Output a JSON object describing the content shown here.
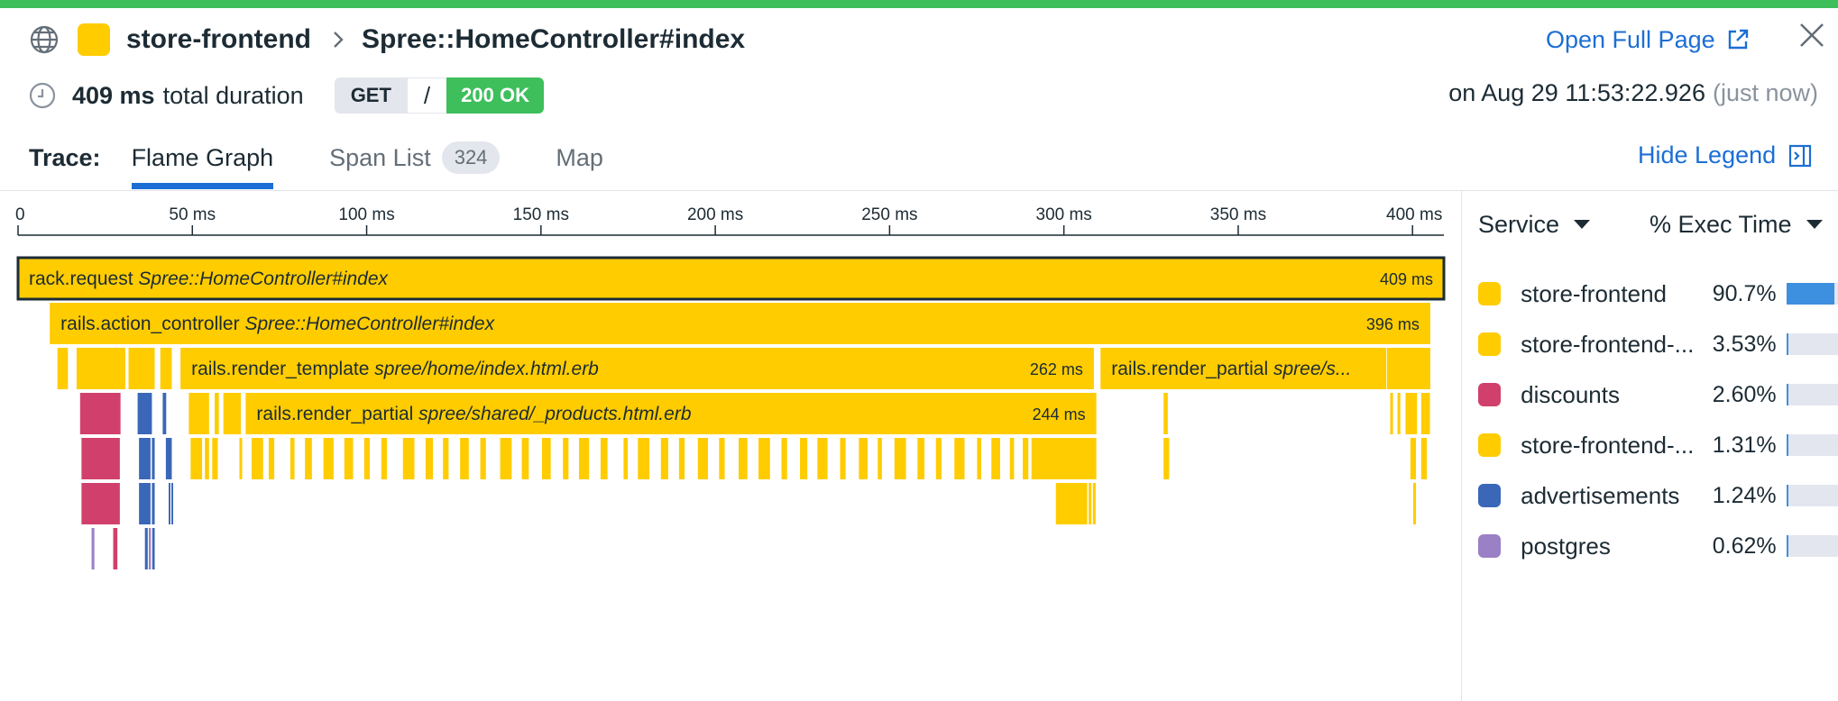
{
  "header": {
    "service": "store-frontend",
    "resource": "Spree::HomeController#index",
    "open_full_page": "Open Full Page",
    "duration_value": "409 ms",
    "duration_label": "total duration",
    "http_method": "GET",
    "http_path": "/",
    "http_status": "200 OK",
    "timestamp": "on Aug 29 11:53:22.926",
    "timestamp_relative": "(just now)"
  },
  "colors": {
    "accent": "#1c6ed4",
    "success": "#3ebf5c",
    "store_frontend": "#ffcc00",
    "discounts": "#d1406c",
    "advertisements": "#3a67b7",
    "postgres": "#9a80c4"
  },
  "tabs": {
    "trace_label": "Trace:",
    "items": [
      {
        "label": "Flame Graph",
        "active": true
      },
      {
        "label": "Span List",
        "count": "324",
        "active": false
      },
      {
        "label": "Map",
        "active": false
      }
    ],
    "hide_legend": "Hide Legend"
  },
  "flame": {
    "axis_max_ms": 409,
    "ticks": [
      {
        "value": 0,
        "label": "0"
      },
      {
        "value": 50,
        "label": "50 ms"
      },
      {
        "value": 100,
        "label": "100 ms"
      },
      {
        "value": 150,
        "label": "150 ms"
      },
      {
        "value": 200,
        "label": "200 ms"
      },
      {
        "value": 250,
        "label": "250 ms"
      },
      {
        "value": 300,
        "label": "300 ms"
      },
      {
        "value": 350,
        "label": "350 ms"
      },
      {
        "value": 400,
        "label": "400 ms"
      }
    ],
    "spans": [
      {
        "depth": 0,
        "start": 0,
        "duration": 409,
        "service": "store_frontend",
        "name": "rack.request",
        "resource": "Spree::HomeController#index",
        "dur_label": "409 ms",
        "selected": true
      },
      {
        "depth": 1,
        "start": 9.1,
        "duration": 396,
        "service": "store_frontend",
        "name": "rails.action_controller",
        "resource": "Spree::HomeController#index",
        "dur_label": "396 ms"
      },
      {
        "depth": 2,
        "start": 46.6,
        "duration": 262,
        "service": "store_frontend",
        "name": "rails.render_template",
        "resource": "spree/home/index.html.erb",
        "dur_label": "262 ms"
      },
      {
        "depth": 2,
        "start": 310.5,
        "duration": 82,
        "service": "store_frontend",
        "name": "rails.render_partial",
        "resource": "spree/s...",
        "dur_label": ""
      },
      {
        "depth": 3,
        "start": 65.3,
        "duration": 244,
        "service": "store_frontend",
        "name": "rails.render_partial",
        "resource": "spree/shared/_products.html.erb",
        "dur_label": "244 ms"
      }
    ],
    "slivers": [
      {
        "depth": 2,
        "start": 11.3,
        "duration": 3,
        "service": "store_frontend"
      },
      {
        "depth": 2,
        "start": 16.8,
        "duration": 14,
        "service": "store_frontend"
      },
      {
        "depth": 2,
        "start": 31.7,
        "duration": 7.5,
        "service": "store_frontend"
      },
      {
        "depth": 2,
        "start": 40.8,
        "duration": 3.3,
        "service": "store_frontend"
      },
      {
        "depth": 2,
        "start": 392.7,
        "duration": 12.4,
        "service": "store_frontend"
      },
      {
        "depth": 3,
        "start": 17.8,
        "duration": 11.6,
        "service": "discounts"
      },
      {
        "depth": 3,
        "start": 34.3,
        "duration": 4.1,
        "service": "advertisements"
      },
      {
        "depth": 3,
        "start": 41.5,
        "duration": 1,
        "service": "advertisements"
      },
      {
        "depth": 3,
        "start": 49,
        "duration": 5.8,
        "service": "store_frontend"
      },
      {
        "depth": 3,
        "start": 56.4,
        "duration": 1.2,
        "service": "store_frontend"
      },
      {
        "depth": 3,
        "start": 58.9,
        "duration": 5,
        "service": "store_frontend"
      },
      {
        "depth": 3,
        "start": 328.6,
        "duration": 1.2,
        "service": "store_frontend"
      },
      {
        "depth": 3,
        "start": 393.6,
        "duration": 0.8,
        "service": "store_frontend"
      },
      {
        "depth": 3,
        "start": 395.7,
        "duration": 0.8,
        "service": "store_frontend"
      },
      {
        "depth": 3,
        "start": 398,
        "duration": 3.3,
        "service": "store_frontend"
      },
      {
        "depth": 3,
        "start": 402.5,
        "duration": 2.5,
        "service": "store_frontend"
      },
      {
        "depth": 4,
        "start": 18.2,
        "duration": 11,
        "service": "discounts"
      },
      {
        "depth": 4,
        "start": 34.7,
        "duration": 3.3,
        "service": "advertisements"
      },
      {
        "depth": 4,
        "start": 38.4,
        "duration": 0.8,
        "service": "advertisements"
      },
      {
        "depth": 4,
        "start": 42.4,
        "duration": 1.7,
        "service": "advertisements"
      },
      {
        "depth": 4,
        "start": 49.5,
        "duration": 3.3,
        "service": "store_frontend"
      },
      {
        "depth": 4,
        "start": 53.6,
        "duration": 1.2,
        "service": "store_frontend"
      },
      {
        "depth": 4,
        "start": 55.7,
        "duration": 1.6,
        "service": "store_frontend"
      },
      {
        "depth": 4,
        "start": 63.5,
        "duration": 0.8,
        "service": "store_frontend"
      },
      {
        "depth": 4,
        "start": 67,
        "duration": 3.3,
        "service": "store_frontend"
      },
      {
        "depth": 4,
        "start": 71.9,
        "duration": 1.6,
        "service": "store_frontend"
      },
      {
        "depth": 4,
        "start": 78.1,
        "duration": 1.2,
        "service": "store_frontend"
      },
      {
        "depth": 4,
        "start": 82.3,
        "duration": 2,
        "service": "store_frontend"
      },
      {
        "depth": 4,
        "start": 87.6,
        "duration": 2.9,
        "service": "store_frontend"
      },
      {
        "depth": 4,
        "start": 93.6,
        "duration": 2.5,
        "service": "store_frontend"
      },
      {
        "depth": 4,
        "start": 99.3,
        "duration": 1.6,
        "service": "store_frontend"
      },
      {
        "depth": 4,
        "start": 104.2,
        "duration": 1.6,
        "service": "store_frontend"
      },
      {
        "depth": 4,
        "start": 110.4,
        "duration": 3.3,
        "service": "store_frontend"
      },
      {
        "depth": 4,
        "start": 116.9,
        "duration": 2.1,
        "service": "store_frontend"
      },
      {
        "depth": 4,
        "start": 121.9,
        "duration": 1.6,
        "service": "store_frontend"
      },
      {
        "depth": 4,
        "start": 126.8,
        "duration": 2.5,
        "service": "store_frontend"
      },
      {
        "depth": 4,
        "start": 132.6,
        "duration": 1.6,
        "service": "store_frontend"
      },
      {
        "depth": 4,
        "start": 138.3,
        "duration": 3.3,
        "service": "store_frontend"
      },
      {
        "depth": 4,
        "start": 144.5,
        "duration": 2,
        "service": "store_frontend"
      },
      {
        "depth": 4,
        "start": 150.3,
        "duration": 2.5,
        "service": "store_frontend"
      },
      {
        "depth": 4,
        "start": 156.3,
        "duration": 1.6,
        "service": "store_frontend"
      },
      {
        "depth": 4,
        "start": 160.9,
        "duration": 2.9,
        "service": "store_frontend"
      },
      {
        "depth": 4,
        "start": 167.1,
        "duration": 2,
        "service": "store_frontend"
      },
      {
        "depth": 4,
        "start": 173.7,
        "duration": 1.2,
        "service": "store_frontend"
      },
      {
        "depth": 4,
        "start": 177.8,
        "duration": 3.3,
        "service": "store_frontend"
      },
      {
        "depth": 4,
        "start": 184.4,
        "duration": 2.1,
        "service": "store_frontend"
      },
      {
        "depth": 4,
        "start": 189.6,
        "duration": 1.6,
        "service": "store_frontend"
      },
      {
        "depth": 4,
        "start": 195,
        "duration": 2.9,
        "service": "store_frontend"
      },
      {
        "depth": 4,
        "start": 201.1,
        "duration": 1.6,
        "service": "store_frontend"
      },
      {
        "depth": 4,
        "start": 206.7,
        "duration": 2.5,
        "service": "store_frontend"
      },
      {
        "depth": 4,
        "start": 212.4,
        "duration": 3.3,
        "service": "store_frontend"
      },
      {
        "depth": 4,
        "start": 219,
        "duration": 1.6,
        "service": "store_frontend"
      },
      {
        "depth": 4,
        "start": 224.3,
        "duration": 2.1,
        "service": "store_frontend"
      },
      {
        "depth": 4,
        "start": 229.3,
        "duration": 2.9,
        "service": "store_frontend"
      },
      {
        "depth": 4,
        "start": 235.8,
        "duration": 1.6,
        "service": "store_frontend"
      },
      {
        "depth": 4,
        "start": 241.2,
        "duration": 2.5,
        "service": "store_frontend"
      },
      {
        "depth": 4,
        "start": 246.6,
        "duration": 1.2,
        "service": "store_frontend"
      },
      {
        "depth": 4,
        "start": 251.4,
        "duration": 3.3,
        "service": "store_frontend"
      },
      {
        "depth": 4,
        "start": 258,
        "duration": 2,
        "service": "store_frontend"
      },
      {
        "depth": 4,
        "start": 263.3,
        "duration": 1.6,
        "service": "store_frontend"
      },
      {
        "depth": 4,
        "start": 268.6,
        "duration": 2.9,
        "service": "store_frontend"
      },
      {
        "depth": 4,
        "start": 275.1,
        "duration": 1.2,
        "service": "store_frontend"
      },
      {
        "depth": 4,
        "start": 279.2,
        "duration": 2.5,
        "service": "store_frontend"
      },
      {
        "depth": 4,
        "start": 284.5,
        "duration": 1.2,
        "service": "store_frontend"
      },
      {
        "depth": 4,
        "start": 288.2,
        "duration": 1.6,
        "service": "store_frontend"
      },
      {
        "depth": 4,
        "start": 290.7,
        "duration": 18.6,
        "service": "store_frontend"
      },
      {
        "depth": 4,
        "start": 328.6,
        "duration": 1.6,
        "service": "store_frontend"
      },
      {
        "depth": 4,
        "start": 399.4,
        "duration": 1.6,
        "service": "store_frontend"
      },
      {
        "depth": 4,
        "start": 402.5,
        "duration": 1.6,
        "service": "store_frontend"
      },
      {
        "depth": 5,
        "start": 18.2,
        "duration": 11,
        "service": "discounts"
      },
      {
        "depth": 5,
        "start": 34.7,
        "duration": 3.3,
        "service": "advertisements"
      },
      {
        "depth": 5,
        "start": 38.4,
        "duration": 0.8,
        "service": "advertisements"
      },
      {
        "depth": 5,
        "start": 43.2,
        "duration": 0.5,
        "service": "advertisements"
      },
      {
        "depth": 5,
        "start": 44,
        "duration": 0.5,
        "service": "advertisements"
      },
      {
        "depth": 5,
        "start": 297.7,
        "duration": 9,
        "service": "store_frontend"
      },
      {
        "depth": 5,
        "start": 307.1,
        "duration": 0.8,
        "service": "store_frontend"
      },
      {
        "depth": 5,
        "start": 308.3,
        "duration": 0.8,
        "service": "store_frontend"
      },
      {
        "depth": 5,
        "start": 400.2,
        "duration": 0.8,
        "service": "store_frontend"
      },
      {
        "depth": 6,
        "start": 21.1,
        "duration": 0.8,
        "service": "postgres"
      },
      {
        "depth": 6,
        "start": 27.3,
        "duration": 1.2,
        "service": "discounts"
      },
      {
        "depth": 6,
        "start": 36.4,
        "duration": 0.8,
        "service": "advertisements"
      },
      {
        "depth": 6,
        "start": 37.5,
        "duration": 0.6,
        "service": "postgres"
      },
      {
        "depth": 6,
        "start": 38.5,
        "duration": 0.7,
        "service": "advertisements"
      }
    ]
  },
  "legend": {
    "service_header": "Service",
    "exec_header": "% Exec Time",
    "items": [
      {
        "name": "store-frontend",
        "pct": "90.7%",
        "fraction": 0.907,
        "color": "#ffcc00"
      },
      {
        "name": "store-frontend-...",
        "pct": "3.53%",
        "fraction": 0.0353,
        "color": "#ffcc00"
      },
      {
        "name": "discounts",
        "pct": "2.60%",
        "fraction": 0.026,
        "color": "#d1406c"
      },
      {
        "name": "store-frontend-...",
        "pct": "1.31%",
        "fraction": 0.0131,
        "color": "#ffcc00"
      },
      {
        "name": "advertisements",
        "pct": "1.24%",
        "fraction": 0.0124,
        "color": "#3a67b7"
      },
      {
        "name": "postgres",
        "pct": "0.62%",
        "fraction": 0.0062,
        "color": "#9a80c4"
      }
    ]
  }
}
